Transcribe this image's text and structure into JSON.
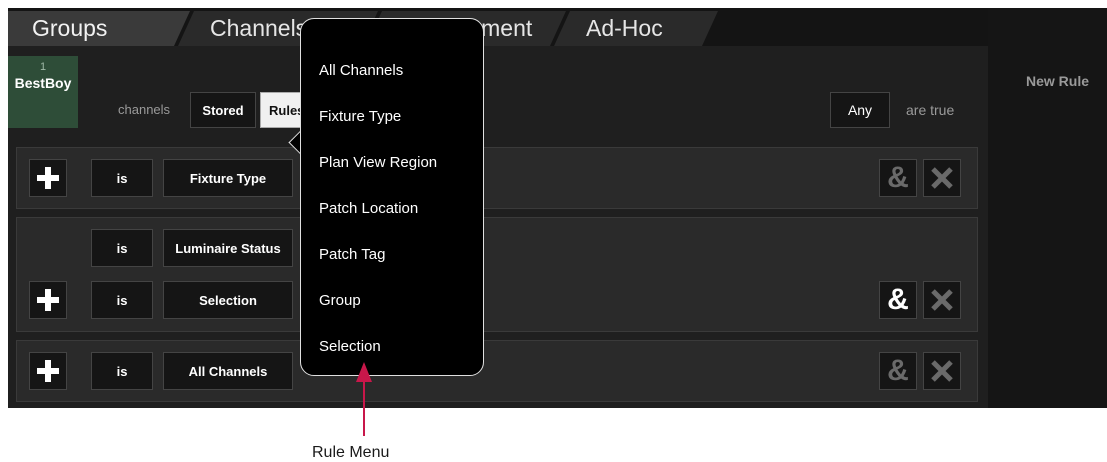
{
  "tabs": [
    {
      "label": "Groups",
      "active": true
    },
    {
      "label": "Channels",
      "active": false
    },
    {
      "label": "Management",
      "active": false
    },
    {
      "label": "Ad-Hoc",
      "active": false
    }
  ],
  "group": {
    "number": "1",
    "name": "BestBoy"
  },
  "header": {
    "channels_label": "channels",
    "stored_button": "Stored",
    "rules_button": "Rules",
    "any_button": "Any",
    "are_true_label": "are true"
  },
  "right_panel": {
    "new_rule": "New Rule"
  },
  "rows": [
    {
      "is_label": "is",
      "type_label": "Fixture Type"
    },
    {
      "is_label": "is",
      "type_label": "Luminaire Status"
    },
    {
      "is_label": "is",
      "type_label": "Selection"
    },
    {
      "is_label": "is",
      "type_label": "All Channels"
    }
  ],
  "rule_menu": {
    "items": [
      "All Channels",
      "Fixture Type",
      "Plan View Region",
      "Patch Location",
      "Patch Tag",
      "Group",
      "Selection"
    ]
  },
  "annotation": {
    "caption": "Rule Menu",
    "color": "#c8174a"
  },
  "icons": {
    "plus": "plus-icon",
    "and": "&",
    "remove": "x-icon"
  },
  "colors": {
    "group_badge": "#2e4d38",
    "background": "#1f1f1f"
  }
}
